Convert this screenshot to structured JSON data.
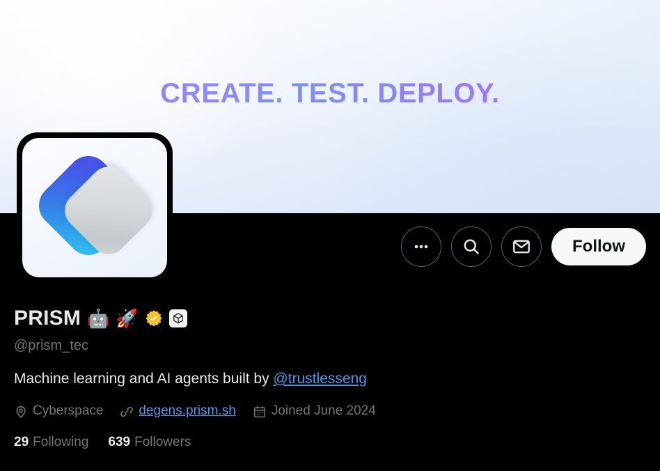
{
  "banner": {
    "headline": "CREATE. TEST. DEPLOY.",
    "gradient_start": "#a86ee8",
    "gradient_end": "#b06ce9",
    "background_top": "#ffffff",
    "background_bottom": "#e8eefb"
  },
  "avatar": {
    "alt": "PRISM logo",
    "blue_gradient_start": "#4f46e5",
    "blue_gradient_end": "#38c5f0",
    "gray_gradient_start": "#e4e6e9",
    "gray_gradient_end": "#c4c8cc",
    "background": "#f2f6fc"
  },
  "actions": {
    "more_label": "More",
    "search_label": "Search profile",
    "message_label": "Message",
    "follow_label": "Follow"
  },
  "profile": {
    "display_name": "PRISM",
    "emoji_robot": "🤖",
    "emoji_rocket": "🚀",
    "badge_verified_label": "Verified",
    "badge_cube_label": "NFT cube badge",
    "handle": "@prism_tec",
    "bio_text": "Machine learning and AI agents built by ",
    "bio_mention": "@trustlesseng",
    "location": "Cyberspace",
    "website": "degens.prism.sh",
    "joined": "Joined June 2024",
    "link_color": "#4a99e9",
    "muted_color": "#71767b"
  },
  "stats": {
    "following_count": "29",
    "following_label": "Following",
    "followers_count": "639",
    "followers_label": "Followers"
  }
}
